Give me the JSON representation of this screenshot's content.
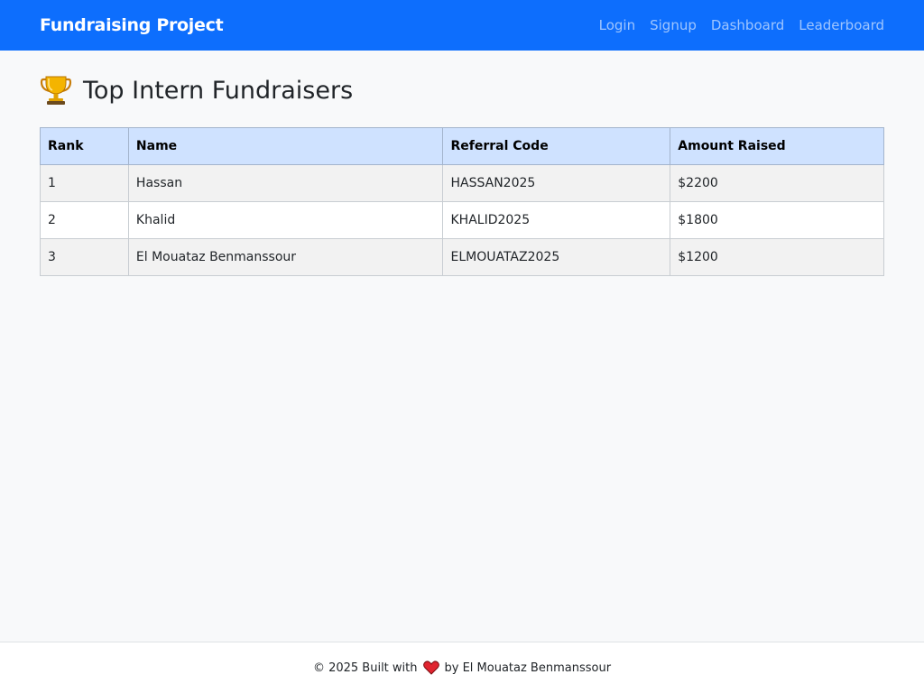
{
  "navbar": {
    "brand": "Fundraising Project",
    "links": [
      "Login",
      "Signup",
      "Dashboard",
      "Leaderboard"
    ]
  },
  "main": {
    "trophy_icon": "trophy-icon",
    "title": "Top Intern Fundraisers",
    "table": {
      "headers": [
        "Rank",
        "Name",
        "Referral Code",
        "Amount Raised"
      ],
      "rows": [
        [
          "1",
          "Hassan",
          "HASSAN2025",
          "$2200"
        ],
        [
          "2",
          "Khalid",
          "KHALID2025",
          "$1800"
        ],
        [
          "3",
          "El Mouataz Benmanssour",
          "ELMOUATAZ2025",
          "$1200"
        ]
      ]
    }
  },
  "footer": {
    "prefix": "© 2025 Built with",
    "heart_icon": "heart-icon",
    "suffix": "by El Mouataz Benmanssour"
  },
  "colors": {
    "navbar_bg": "#0d6efd",
    "table_header_bg": "#cfe2ff",
    "page_bg": "#f8f9fa"
  }
}
